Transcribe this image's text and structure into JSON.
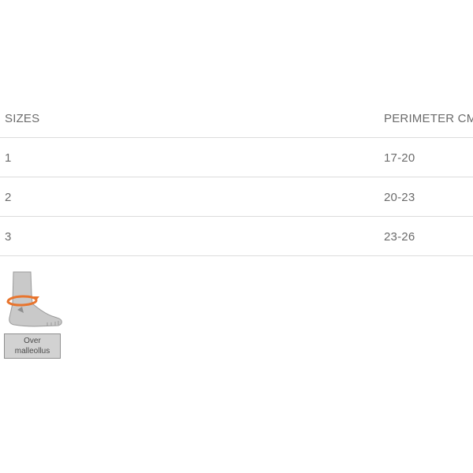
{
  "table": {
    "headers": {
      "size": "SIZES",
      "perimeter": "PERIMETER CM"
    },
    "rows": [
      {
        "size": "1",
        "perimeter": "17-20"
      },
      {
        "size": "2",
        "perimeter": "20-23"
      },
      {
        "size": "3",
        "perimeter": "23-26"
      }
    ]
  },
  "measure_figure": {
    "icon": "ankle-measurement-icon",
    "caption_line1": "Over",
    "caption_line2": "malleollus",
    "accent_color": "#e8752e"
  }
}
